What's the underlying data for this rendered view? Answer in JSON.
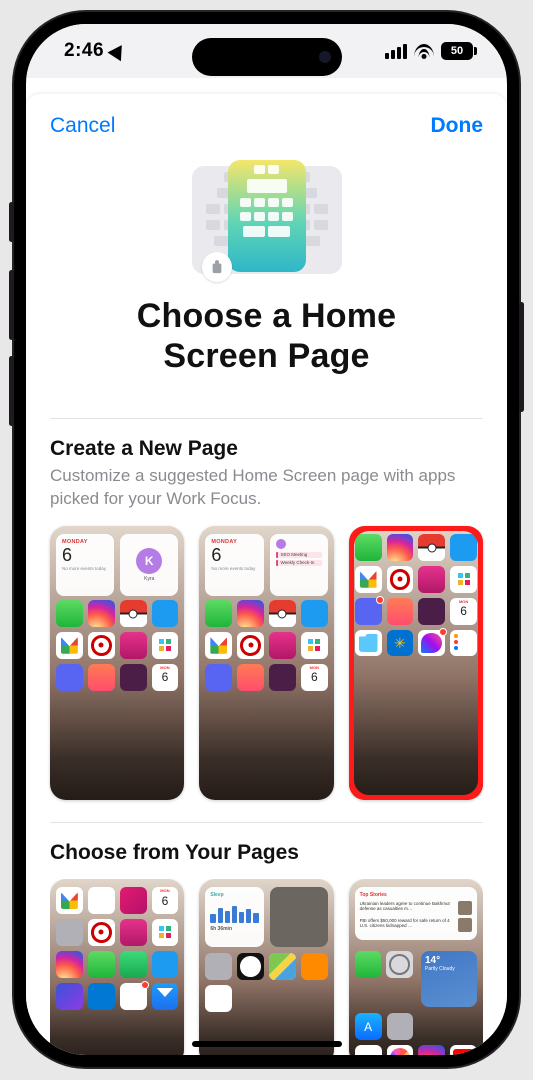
{
  "status": {
    "time": "2:46",
    "battery": "50"
  },
  "nav": {
    "cancel": "Cancel",
    "done": "Done"
  },
  "hero": {
    "title_line1": "Choose a Home",
    "title_line2": "Screen Page"
  },
  "sections": {
    "create": {
      "title": "Create a New Page",
      "desc": "Customize a suggested Home Screen page with apps picked for your Work Focus."
    },
    "choose": {
      "title": "Choose from Your Pages"
    }
  },
  "cal_widget": {
    "dow": "MONDAY",
    "day": "6",
    "sub": "No more events today"
  },
  "contact_widget": {
    "initial": "K",
    "name": "Kyra"
  },
  "sched_widget": {
    "dow": "MONDAY",
    "day": "6",
    "item1": "SEO Meeting",
    "item2": "Weekly Check-In"
  },
  "news_widget": {
    "header": "Top Stories",
    "item1": "Ukrainian leaders agree to continue Bakhmut defense as casualties m…",
    "item2": "FBI offers $50,000 reward for safe return of 4 U.S. citizens kidnapped …"
  },
  "sleep_widget": {
    "label": "Sleep",
    "range": "6h 36min"
  },
  "weather_widget": {
    "temp": "14°",
    "cond": "Partly Cloudy"
  },
  "icons": {
    "phone": "Phone",
    "insta": "Instagram",
    "poke": "Pokémon GO",
    "twitter": "Twitter",
    "gmail": "Gmail",
    "target": "Target",
    "lips": "Notes",
    "slack": "Slack",
    "discord": "Discord",
    "stretch": "Stretch",
    "libby": "Libby",
    "calendar": "Calendar",
    "files": "Files",
    "walmart": "Walmart",
    "messenger": "Messenger",
    "reminders": "Reminders",
    "ba": "BA",
    "cal_small_dow": "MON",
    "cal_small_day": "6"
  }
}
